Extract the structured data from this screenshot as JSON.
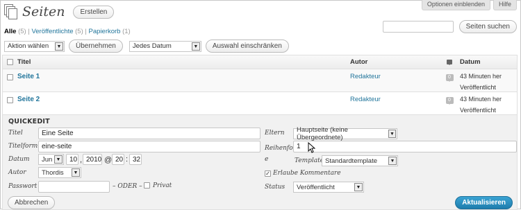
{
  "screen_tabs": {
    "screen_options": "Optionen einblenden",
    "help": "Hilfe"
  },
  "header": {
    "title": "Seiten",
    "add_new": "Erstellen"
  },
  "filters": {
    "all_label": "Alle",
    "all_count": "(5)",
    "published_label": "Veröffentlichte",
    "published_count": "(5)",
    "trash_label": "Papierkorb",
    "trash_count": "(1)",
    "separator": "|"
  },
  "search": {
    "value": "",
    "button": "Seiten suchen"
  },
  "bulk": {
    "action_value": "Aktion wählen",
    "apply": "Übernehmen",
    "date_value": "Jedes Datum",
    "filter": "Auswahl einschränken"
  },
  "table": {
    "columns": {
      "title": "Titel",
      "author": "Autor",
      "date": "Datum"
    },
    "rows": [
      {
        "title": "Seite 1",
        "author": "Redakteur",
        "comments": "0",
        "date_line1": "43 Minuten her",
        "date_line2": "Veröffentlicht"
      },
      {
        "title": "Seite 2",
        "author": "Redakteur",
        "comments": "0",
        "date_line1": "43 Minuten her",
        "date_line2": "Veröffentlicht"
      }
    ]
  },
  "quickedit": {
    "heading": "QUICKEDIT",
    "title_label": "Titel",
    "title_value": "Eine Seite",
    "slug_label": "Titelform",
    "slug_value": "eine-seite",
    "date_label": "Datum",
    "date_month": "Jun",
    "date_day": "10",
    "date_year": "2010",
    "date_at": "@",
    "date_hour": "20",
    "date_colon": ":",
    "date_min": "32",
    "date_comma": ",",
    "author_label": "Autor",
    "author_value": "Thordis",
    "password_label": "Passwort",
    "password_value": "",
    "or_label": "– ODER –",
    "private_label": "Privat",
    "parent_label": "Eltern",
    "parent_value": "Hauptseite (keine Übergeordnete)",
    "order_label_1": "Reihenfolg",
    "order_label_2": "e",
    "order_value": "1",
    "template_label": "Template",
    "template_value": "Standardtemplate",
    "comments_label": "Erlaube Kommentare",
    "status_label": "Status",
    "status_value": "Veröffentlicht",
    "cancel": "Abbrechen",
    "update": "Aktualisieren"
  },
  "colors": {
    "link": "#21759b",
    "primary": "#2583b3"
  }
}
